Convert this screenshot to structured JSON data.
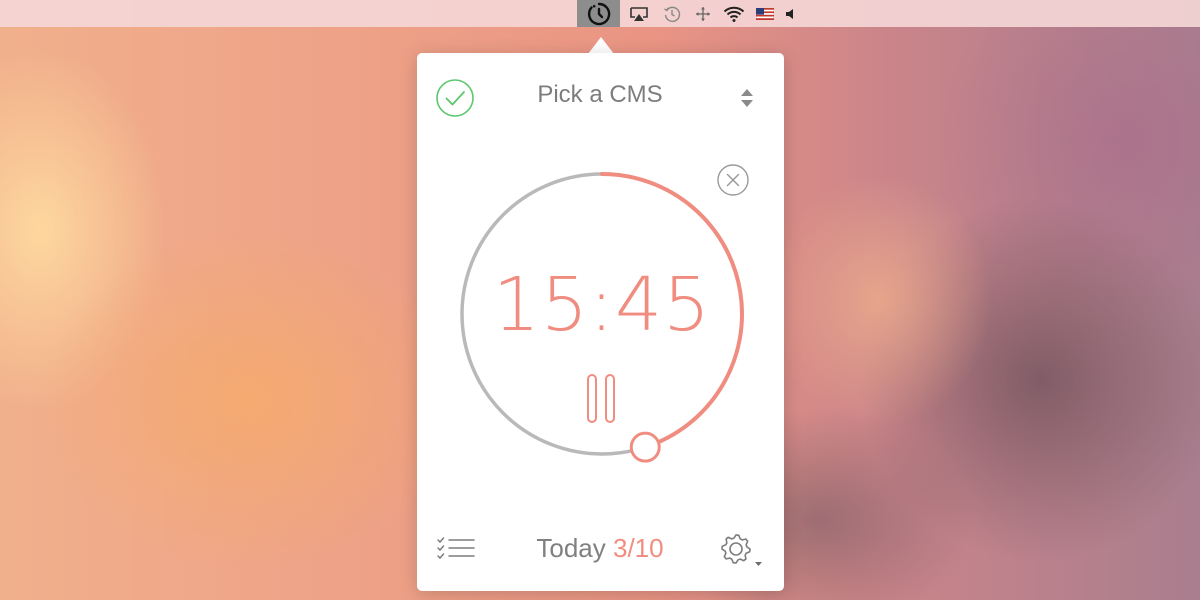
{
  "menubar": {
    "items": [
      {
        "name": "timer-icon",
        "active": true
      },
      {
        "name": "airplay-icon"
      },
      {
        "name": "time-machine-icon"
      },
      {
        "name": "move-arrows-icon"
      },
      {
        "name": "wifi-icon"
      },
      {
        "name": "us-flag-icon"
      },
      {
        "name": "volume-icon"
      }
    ]
  },
  "popover": {
    "task_title": "Pick a CMS",
    "timer": {
      "time": "15:45",
      "progress_fraction": 0.45
    },
    "footer": {
      "today_label": "Today",
      "count": "3/10"
    }
  },
  "colors": {
    "accent": "#f08d80",
    "check_green": "#5cc86e",
    "track_gray": "#b9b9b9",
    "text_gray": "#7d7d7d"
  }
}
